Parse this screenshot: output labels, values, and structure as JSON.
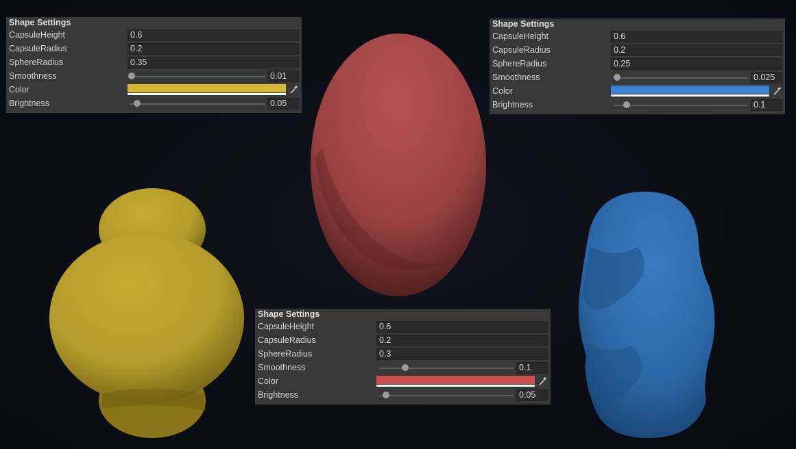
{
  "panels": [
    {
      "title": "Shape Settings",
      "capsule_height_label": "CapsuleHeight",
      "capsule_height": "0.6",
      "capsule_radius_label": "CapsuleRadius",
      "capsule_radius": "0.2",
      "sphere_radius_label": "SphereRadius",
      "sphere_radius": "0.35",
      "smoothness_label": "Smoothness",
      "smoothness": "0.01",
      "smoothness_fraction": 0.01,
      "color_label": "Color",
      "color": "#d6b531",
      "brightness_label": "Brightness",
      "brightness": "0.05",
      "brightness_fraction": 0.05
    },
    {
      "title": "Shape Settings",
      "capsule_height_label": "CapsuleHeight",
      "capsule_height": "0.6",
      "capsule_radius_label": "CapsuleRadius",
      "capsule_radius": "0.2",
      "sphere_radius_label": "SphereRadius",
      "sphere_radius": "0.25",
      "smoothness_label": "Smoothness",
      "smoothness": "0.025",
      "smoothness_fraction": 0.025,
      "color_label": "Color",
      "color": "#3d7fd1",
      "brightness_label": "Brightness",
      "brightness": "0.1",
      "brightness_fraction": 0.1
    },
    {
      "title": "Shape Settings",
      "capsule_height_label": "CapsuleHeight",
      "capsule_height": "0.6",
      "capsule_radius_label": "CapsuleRadius",
      "capsule_radius": "0.2",
      "sphere_radius_label": "SphereRadius",
      "sphere_radius": "0.3",
      "smoothness_label": "Smoothness",
      "smoothness": "0.1",
      "smoothness_fraction": 0.2,
      "color_label": "Color",
      "color": "#c94f4f",
      "brightness_label": "Brightness",
      "brightness": "0.05",
      "brightness_fraction": 0.05
    }
  ],
  "shapes": {
    "yellow": "#b8a02a",
    "red": "#a84848",
    "blue": "#2c6bad"
  }
}
